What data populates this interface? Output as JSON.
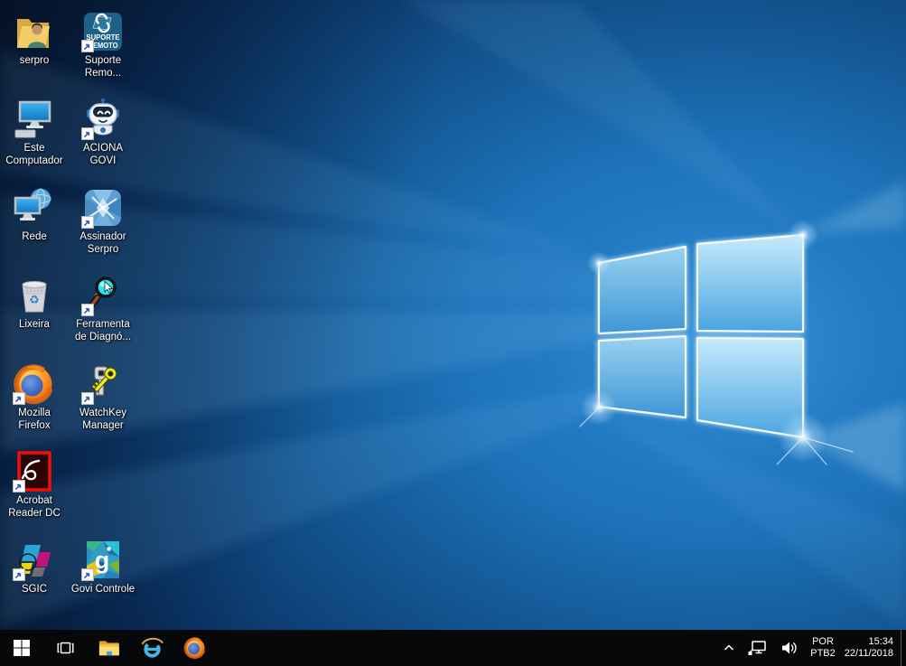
{
  "desktop": {
    "icons": [
      {
        "name": "serpro",
        "label": "serpro"
      },
      {
        "name": "suporte-remoto",
        "label": "Suporte\nRemo...",
        "icon_text_line1": "SUPORTE",
        "icon_text_line2": "REMOTO"
      },
      {
        "name": "este-computador",
        "label": "Este\nComputador"
      },
      {
        "name": "aciona-govi",
        "label": "ACIONA\nGOVI"
      },
      {
        "name": "rede",
        "label": "Rede"
      },
      {
        "name": "assinador-serpro",
        "label": "Assinador\nSerpro"
      },
      {
        "name": "lixeira",
        "label": "Lixeira"
      },
      {
        "name": "ferramenta-diagnostico",
        "label": "Ferramenta\nde Diagnó..."
      },
      {
        "name": "mozilla-firefox",
        "label": "Mozilla\nFirefox"
      },
      {
        "name": "watchkey-manager",
        "label": "WatchKey\nManager"
      },
      {
        "name": "acrobat-reader-dc",
        "label": "Acrobat\nReader DC"
      },
      {
        "name": "sgic",
        "label": "SGIC"
      },
      {
        "name": "govi-controle",
        "label": "Govi Controle",
        "icon_letter": "g"
      }
    ]
  },
  "taskbar": {
    "tray": {
      "language_code": "POR",
      "keyboard_layout": "PTB2",
      "time": "15:34",
      "date": "22/11/2018"
    }
  },
  "colors": {
    "taskbar_bg": "#060809",
    "wallpaper_deep": "#05132a",
    "wallpaper_bright": "#2e8ed6",
    "logo_pane_top": "#9bd2f0",
    "logo_pane_bottom": "#3d96d6"
  }
}
